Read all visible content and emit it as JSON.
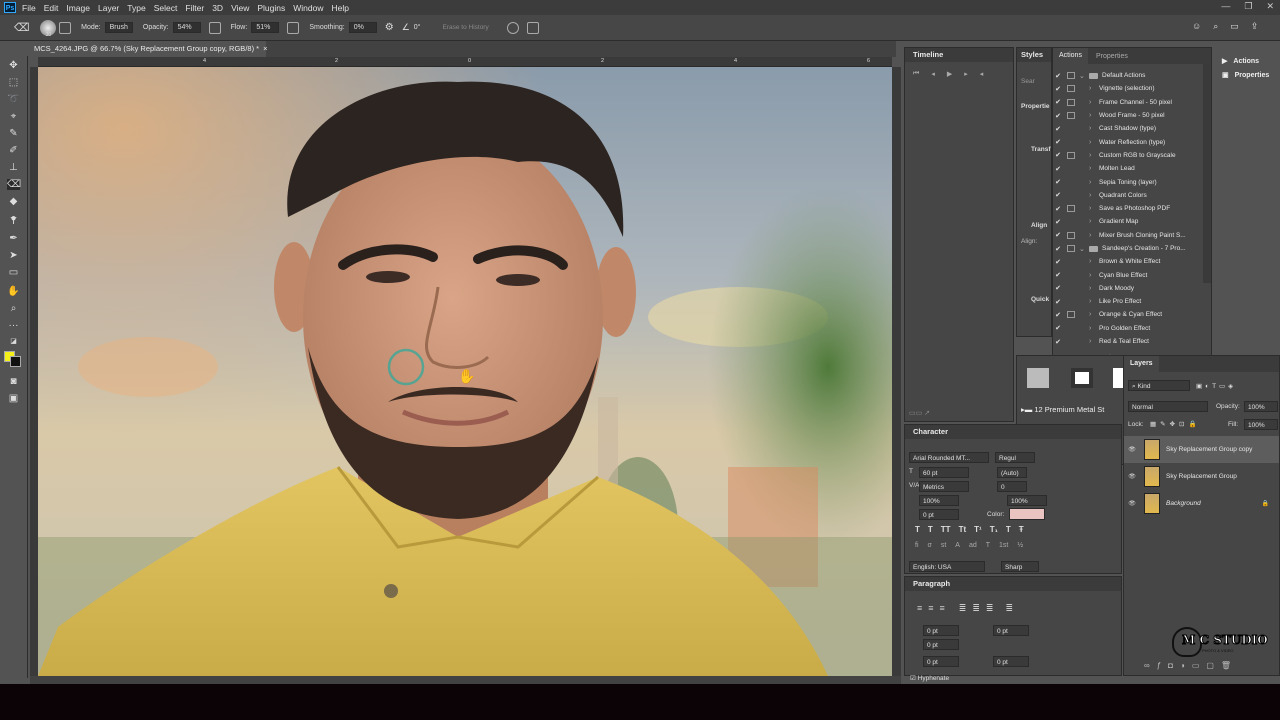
{
  "menu": {
    "app_icon": "Ps",
    "items": [
      "File",
      "Edit",
      "Image",
      "Layer",
      "Type",
      "Select",
      "Filter",
      "3D",
      "View",
      "Plugins",
      "Window",
      "Help"
    ]
  },
  "options": {
    "brush_size": "30",
    "mode_label": "Mode:",
    "mode_value": "Brush",
    "opacity_label": "Opacity:",
    "opacity_value": "54%",
    "flow_label": "Flow:",
    "flow_value": "51%",
    "smoothing_label": "Smoothing:",
    "smoothing_value": "0%",
    "angle_value": "0°",
    "erase_history": "Erase to History"
  },
  "document": {
    "tab_title": "MCS_4264.JPG @ 66.7% (Sky Replacement Group copy, RGB/8) *",
    "ruler_marks": [
      "4",
      "2",
      "0",
      "2",
      "4",
      "6"
    ]
  },
  "colors": {
    "foreground": "#f5ef1a",
    "background": "#111111",
    "accent": "#31a8ff",
    "text_color_swatch": "#e9c4c0"
  },
  "timeline": {
    "title": "Timeline"
  },
  "styles_tab": {
    "title": "Styles",
    "search": "Sear",
    "properties": "Propertie",
    "transform": "Transf",
    "align": "Align",
    "align_label": "Align:",
    "quick": "Quick"
  },
  "actions_panel": {
    "tabs": [
      "Actions",
      "Properties"
    ],
    "rows": [
      {
        "label": "Default Actions",
        "type": "folder",
        "open": true,
        "box": true
      },
      {
        "label": "Vignette (selection)",
        "type": "item",
        "box": true
      },
      {
        "label": "Frame Channel - 50 pixel",
        "type": "item",
        "box": true
      },
      {
        "label": "Wood Frame - 50 pixel",
        "type": "item",
        "box": true
      },
      {
        "label": "Cast Shadow (type)",
        "type": "item",
        "box": false
      },
      {
        "label": "Water Reflection (type)",
        "type": "item",
        "box": false
      },
      {
        "label": "Custom RGB to Grayscale",
        "type": "item",
        "box": true
      },
      {
        "label": "Molten Lead",
        "type": "item",
        "box": false
      },
      {
        "label": "Sepia Toning (layer)",
        "type": "item",
        "box": false
      },
      {
        "label": "Quadrant Colors",
        "type": "item",
        "box": false
      },
      {
        "label": "Save as Photoshop PDF",
        "type": "item",
        "box": true
      },
      {
        "label": "Gradient Map",
        "type": "item",
        "box": false
      },
      {
        "label": "Mixer Brush Cloning Paint S...",
        "type": "item",
        "box": true
      },
      {
        "label": "Sandeep's Creation - 7 Pro...",
        "type": "folder",
        "open": true,
        "box": true
      },
      {
        "label": "Brown & White Effect",
        "type": "item",
        "box": false
      },
      {
        "label": "Cyan Blue Effect",
        "type": "item",
        "box": false
      },
      {
        "label": "Dark Moody",
        "type": "item",
        "box": false
      },
      {
        "label": "Like Pro Effect",
        "type": "item",
        "box": false
      },
      {
        "label": "Orange & Cyan Effect",
        "type": "item",
        "box": true
      },
      {
        "label": "Pro Golden Effect",
        "type": "item",
        "box": false
      },
      {
        "label": "Red & Teal Effect",
        "type": "item",
        "box": false
      }
    ]
  },
  "side_dock": {
    "actions": "Actions",
    "properties": "Properties"
  },
  "swatches": {
    "preset_title": "12 Premium Metal St"
  },
  "character": {
    "title": "Character",
    "font": "Arial Rounded MT...",
    "style": "Regul",
    "size": "60 pt",
    "leading": "(Auto)",
    "kerning": "Metrics",
    "tracking": "0",
    "vscale": "100%",
    "hscale": "100%",
    "baseline": "0 pt",
    "color_label": "Color:",
    "language": "English: USA",
    "aa": "Sharp",
    "type_styles": [
      "T",
      "T",
      "TT",
      "Tt",
      "T¹",
      "T₁",
      "T",
      "Ŧ"
    ],
    "open_type": [
      "fi",
      "σ",
      "st",
      "A",
      "ad",
      "T",
      "1st",
      "½"
    ]
  },
  "paragraph": {
    "title": "Paragraph",
    "indent_left": "0 pt",
    "indent_right": "0 pt",
    "indent_first": "0 pt",
    "space_before": "0 pt",
    "space_after": "0 pt",
    "hyphenate": "Hyphenate"
  },
  "layers": {
    "title": "Layers",
    "kind": "Kind",
    "blend": "Normal",
    "opacity_label": "Opacity:",
    "opacity": "100%",
    "lock_label": "Lock:",
    "fill_label": "Fill:",
    "fill": "100%",
    "rows": [
      {
        "name": "Sky Replacement Group copy",
        "selected": true
      },
      {
        "name": "Sky Replacement Group",
        "selected": false
      },
      {
        "name": "Background",
        "selected": false,
        "italic": true,
        "locked": true
      }
    ]
  },
  "watermark": {
    "text": "M C STUDIO",
    "sub": "PHOTO & VIDEO"
  }
}
